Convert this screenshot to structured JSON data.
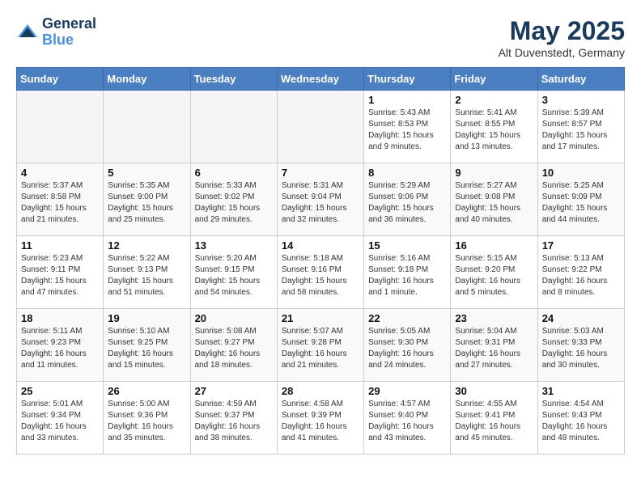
{
  "header": {
    "logo_line1": "General",
    "logo_line2": "Blue",
    "month_year": "May 2025",
    "location": "Alt Duvenstedt, Germany"
  },
  "weekdays": [
    "Sunday",
    "Monday",
    "Tuesday",
    "Wednesday",
    "Thursday",
    "Friday",
    "Saturday"
  ],
  "weeks": [
    [
      {
        "day": "",
        "info": ""
      },
      {
        "day": "",
        "info": ""
      },
      {
        "day": "",
        "info": ""
      },
      {
        "day": "",
        "info": ""
      },
      {
        "day": "1",
        "info": "Sunrise: 5:43 AM\nSunset: 8:53 PM\nDaylight: 15 hours\nand 9 minutes."
      },
      {
        "day": "2",
        "info": "Sunrise: 5:41 AM\nSunset: 8:55 PM\nDaylight: 15 hours\nand 13 minutes."
      },
      {
        "day": "3",
        "info": "Sunrise: 5:39 AM\nSunset: 8:57 PM\nDaylight: 15 hours\nand 17 minutes."
      }
    ],
    [
      {
        "day": "4",
        "info": "Sunrise: 5:37 AM\nSunset: 8:58 PM\nDaylight: 15 hours\nand 21 minutes."
      },
      {
        "day": "5",
        "info": "Sunrise: 5:35 AM\nSunset: 9:00 PM\nDaylight: 15 hours\nand 25 minutes."
      },
      {
        "day": "6",
        "info": "Sunrise: 5:33 AM\nSunset: 9:02 PM\nDaylight: 15 hours\nand 29 minutes."
      },
      {
        "day": "7",
        "info": "Sunrise: 5:31 AM\nSunset: 9:04 PM\nDaylight: 15 hours\nand 32 minutes."
      },
      {
        "day": "8",
        "info": "Sunrise: 5:29 AM\nSunset: 9:06 PM\nDaylight: 15 hours\nand 36 minutes."
      },
      {
        "day": "9",
        "info": "Sunrise: 5:27 AM\nSunset: 9:08 PM\nDaylight: 15 hours\nand 40 minutes."
      },
      {
        "day": "10",
        "info": "Sunrise: 5:25 AM\nSunset: 9:09 PM\nDaylight: 15 hours\nand 44 minutes."
      }
    ],
    [
      {
        "day": "11",
        "info": "Sunrise: 5:23 AM\nSunset: 9:11 PM\nDaylight: 15 hours\nand 47 minutes."
      },
      {
        "day": "12",
        "info": "Sunrise: 5:22 AM\nSunset: 9:13 PM\nDaylight: 15 hours\nand 51 minutes."
      },
      {
        "day": "13",
        "info": "Sunrise: 5:20 AM\nSunset: 9:15 PM\nDaylight: 15 hours\nand 54 minutes."
      },
      {
        "day": "14",
        "info": "Sunrise: 5:18 AM\nSunset: 9:16 PM\nDaylight: 15 hours\nand 58 minutes."
      },
      {
        "day": "15",
        "info": "Sunrise: 5:16 AM\nSunset: 9:18 PM\nDaylight: 16 hours\nand 1 minute."
      },
      {
        "day": "16",
        "info": "Sunrise: 5:15 AM\nSunset: 9:20 PM\nDaylight: 16 hours\nand 5 minutes."
      },
      {
        "day": "17",
        "info": "Sunrise: 5:13 AM\nSunset: 9:22 PM\nDaylight: 16 hours\nand 8 minutes."
      }
    ],
    [
      {
        "day": "18",
        "info": "Sunrise: 5:11 AM\nSunset: 9:23 PM\nDaylight: 16 hours\nand 11 minutes."
      },
      {
        "day": "19",
        "info": "Sunrise: 5:10 AM\nSunset: 9:25 PM\nDaylight: 16 hours\nand 15 minutes."
      },
      {
        "day": "20",
        "info": "Sunrise: 5:08 AM\nSunset: 9:27 PM\nDaylight: 16 hours\nand 18 minutes."
      },
      {
        "day": "21",
        "info": "Sunrise: 5:07 AM\nSunset: 9:28 PM\nDaylight: 16 hours\nand 21 minutes."
      },
      {
        "day": "22",
        "info": "Sunrise: 5:05 AM\nSunset: 9:30 PM\nDaylight: 16 hours\nand 24 minutes."
      },
      {
        "day": "23",
        "info": "Sunrise: 5:04 AM\nSunset: 9:31 PM\nDaylight: 16 hours\nand 27 minutes."
      },
      {
        "day": "24",
        "info": "Sunrise: 5:03 AM\nSunset: 9:33 PM\nDaylight: 16 hours\nand 30 minutes."
      }
    ],
    [
      {
        "day": "25",
        "info": "Sunrise: 5:01 AM\nSunset: 9:34 PM\nDaylight: 16 hours\nand 33 minutes."
      },
      {
        "day": "26",
        "info": "Sunrise: 5:00 AM\nSunset: 9:36 PM\nDaylight: 16 hours\nand 35 minutes."
      },
      {
        "day": "27",
        "info": "Sunrise: 4:59 AM\nSunset: 9:37 PM\nDaylight: 16 hours\nand 38 minutes."
      },
      {
        "day": "28",
        "info": "Sunrise: 4:58 AM\nSunset: 9:39 PM\nDaylight: 16 hours\nand 41 minutes."
      },
      {
        "day": "29",
        "info": "Sunrise: 4:57 AM\nSunset: 9:40 PM\nDaylight: 16 hours\nand 43 minutes."
      },
      {
        "day": "30",
        "info": "Sunrise: 4:55 AM\nSunset: 9:41 PM\nDaylight: 16 hours\nand 45 minutes."
      },
      {
        "day": "31",
        "info": "Sunrise: 4:54 AM\nSunset: 9:43 PM\nDaylight: 16 hours\nand 48 minutes."
      }
    ]
  ]
}
